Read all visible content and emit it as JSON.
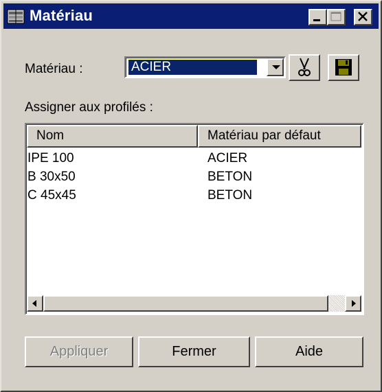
{
  "window": {
    "title": "Matériau",
    "title_icon": "material-app-icon",
    "controls": [
      "minimize-icon",
      "maximize-icon",
      "close-icon"
    ]
  },
  "form": {
    "material_label": "Matériau :",
    "material_value": "ACIER",
    "cut_icon": "scissors-icon",
    "save_icon": "floppy-save-icon",
    "assign_label": "Assigner aux profilés :"
  },
  "list": {
    "columns": [
      "Nom",
      "Matériau par défaut"
    ],
    "rows": [
      {
        "name": "IPE 100",
        "material": "ACIER"
      },
      {
        "name": "B 30x50",
        "material": "BETON"
      },
      {
        "name": "C 45x45",
        "material": "BETON"
      }
    ]
  },
  "buttons": {
    "apply": "Appliquer",
    "close": "Fermer",
    "help": "Aide"
  },
  "colors": {
    "titlebar": "#0a1e73",
    "selection": "#0a246a",
    "face": "#d4d0c8"
  }
}
